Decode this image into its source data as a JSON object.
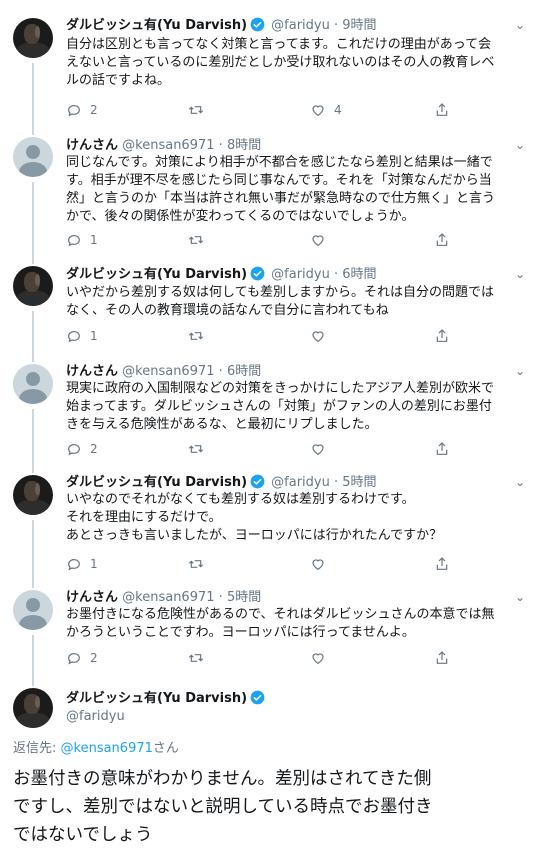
{
  "tweets": [
    {
      "author": "ダルビッシュ有(Yu Darvish)",
      "handle": "@faridyu",
      "dot": "·",
      "time": "9時間",
      "text": "自分は区別とも言ってなく対策と言ってます。これだけの理由があって会\nえないと言っているのに差別だとしか受け取れないのはその人の教育レベ\nルの話ですよね。",
      "replies": "2",
      "retweets": "",
      "likes": "4"
    },
    {
      "author": "けんさん",
      "handle": "@kensan6971",
      "dot": "·",
      "time": "8時間",
      "text": "同じなんです。対策により相手が不都合を感じたなら差別と結果は一緒で\nす。相手が理不尽を感じたら同じ事なんです。それを「対策なんだから当\n然」と言うのか「本当は許され無い事だが緊急時なので仕方無く」と言う\nかで、後々の関係性が変わってくるのではないでしょうか。",
      "replies": "1",
      "retweets": "",
      "likes": ""
    },
    {
      "author": "ダルビッシュ有(Yu Darvish)",
      "handle": "@faridyu",
      "dot": "·",
      "time": "6時間",
      "text": "いやだから差別する奴は何しても差別しますから。それは自分の問題では\nなく、その人の教育環境の話なんで自分に言われてもね",
      "replies": "1",
      "retweets": "",
      "likes": ""
    },
    {
      "author": "けんさん",
      "handle": "@kensan6971",
      "dot": "·",
      "time": "6時間",
      "text": "現実に政府の入国制限などの対策をきっかけにしたアジア人差別が欧米で\n始まってます。ダルビッシュさんの「対策」がファンの人の差別にお墨付\nきを与える危険性があるな、と最初にリプしました。",
      "replies": "2",
      "retweets": "",
      "likes": ""
    },
    {
      "author": "ダルビッシュ有(Yu Darvish)",
      "handle": "@faridyu",
      "dot": "·",
      "time": "5時間",
      "text": "いやなのでそれがなくても差別する奴は差別するわけです。\nそれを理由にするだけで。\nあとさっきも言いましたが、ヨーロッパには行かれたんですか？",
      "replies": "1",
      "retweets": "",
      "likes": ""
    },
    {
      "author": "けんさん",
      "handle": "@kensan6971",
      "dot": "·",
      "time": "5時間",
      "text": "お墨付きになる危険性があるので、それはダルビッシュさんの本意では無\nかろうということですわ。ヨーロッパには行ってませんよ。",
      "replies": "2",
      "retweets": "",
      "likes": ""
    }
  ],
  "main_tweet": {
    "author": "ダルビッシュ有(Yu Darvish)",
    "handle": "@faridyu",
    "reply_to_label": "返信先: ",
    "reply_to_handle": "@kensan6971",
    "reply_to_suffix": "さん",
    "text": "お墨付きの意味がわかりません。差別はされてきた側\nですし、差別ではないと説明している時点でお墨付き\nではないでしょう"
  },
  "icons": {
    "verified": "verified-badge-icon",
    "reply": "reply-icon",
    "retweet": "retweet-icon",
    "like": "heart-icon",
    "share": "share-icon",
    "more": "chevron-down-icon"
  },
  "colors": {
    "verified": "#1da1f2",
    "muted": "#657786",
    "text": "#14171a",
    "mention": "#1da1f2",
    "thread_line": "#ccd6dd"
  }
}
